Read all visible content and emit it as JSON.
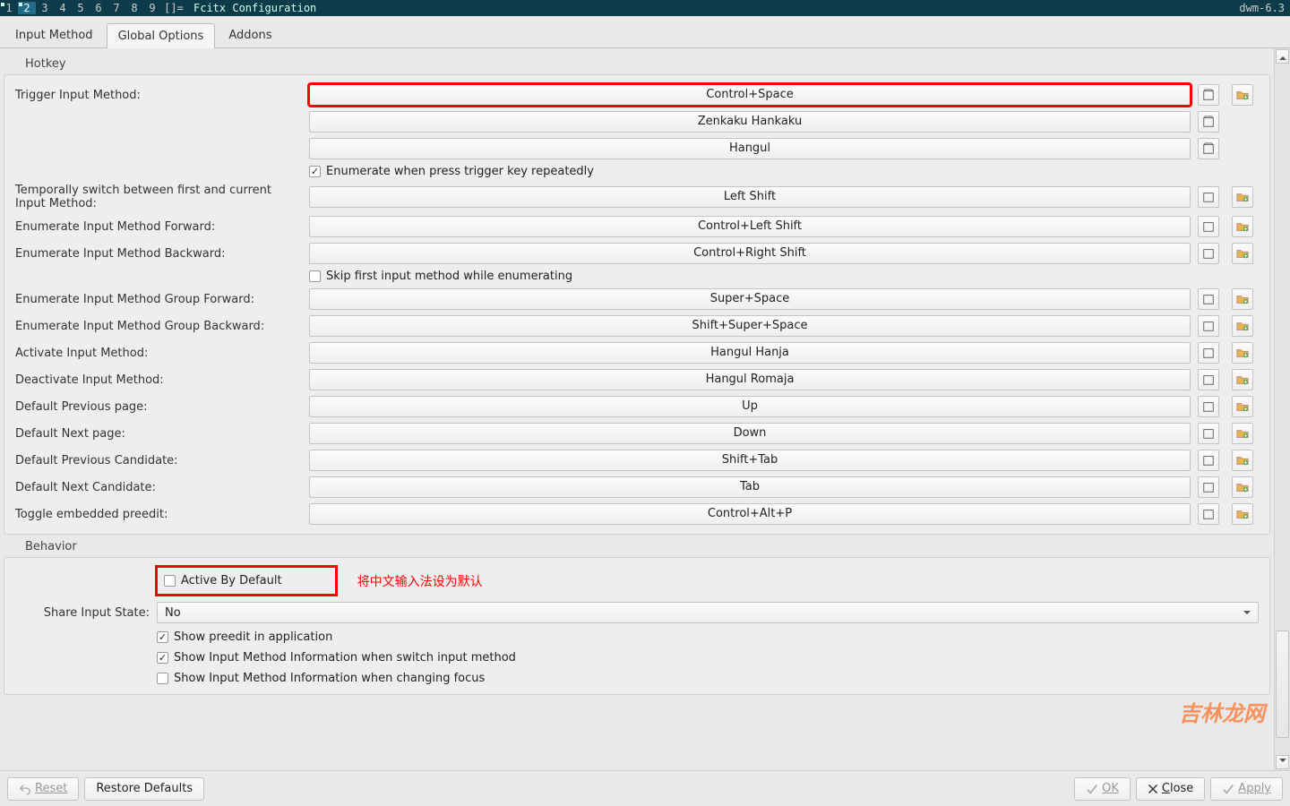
{
  "wm": {
    "tags": [
      "1",
      "2",
      "3",
      "4",
      "5",
      "6",
      "7",
      "8",
      "9"
    ],
    "active_tag": "2",
    "layout": "[]=",
    "title": "Fcitx Configuration",
    "version": "dwm-6.3"
  },
  "tabs": {
    "input_method": "Input Method",
    "global_options": "Global Options",
    "addons": "Addons"
  },
  "sections": {
    "hotkey": "Hotkey",
    "behavior": "Behavior"
  },
  "hotkey": {
    "trigger_label": "Trigger Input Method:",
    "trigger_values": [
      "Control+Space",
      "Zenkaku Hankaku",
      "Hangul"
    ],
    "enumerate_repeat": "Enumerate when press trigger key repeatedly",
    "rows": [
      {
        "label": "Temporally switch between first and current Input Method:",
        "value": "Left Shift"
      },
      {
        "label": "Enumerate Input Method Forward:",
        "value": "Control+Left Shift"
      },
      {
        "label": "Enumerate Input Method Backward:",
        "value": "Control+Right Shift"
      }
    ],
    "skip_first": "Skip first input method while enumerating",
    "rows2": [
      {
        "label": "Enumerate Input Method Group Forward:",
        "value": "Super+Space"
      },
      {
        "label": "Enumerate Input Method Group Backward:",
        "value": "Shift+Super+Space"
      },
      {
        "label": "Activate Input Method:",
        "value": "Hangul Hanja"
      },
      {
        "label": "Deactivate Input Method:",
        "value": "Hangul Romaja"
      },
      {
        "label": "Default Previous page:",
        "value": "Up"
      },
      {
        "label": "Default Next page:",
        "value": "Down"
      },
      {
        "label": "Default Previous Candidate:",
        "value": "Shift+Tab"
      },
      {
        "label": "Default Next Candidate:",
        "value": "Tab"
      },
      {
        "label": "Toggle embedded preedit:",
        "value": "Control+Alt+P"
      }
    ]
  },
  "behavior": {
    "active_by_default": "Active By Default",
    "annotation": "将中文输入法设为默认",
    "share_label": "Share Input State:",
    "share_value": "No",
    "show_preedit": "Show preedit in application",
    "show_im_switch": "Show Input Method Information when switch input method",
    "show_im_focus": "Show Input Method Information when changing focus"
  },
  "buttons": {
    "reset": "Reset",
    "restore": "Restore Defaults",
    "ok": "OK",
    "close": "Close",
    "apply": "Apply"
  },
  "watermark": "吉林龙网"
}
